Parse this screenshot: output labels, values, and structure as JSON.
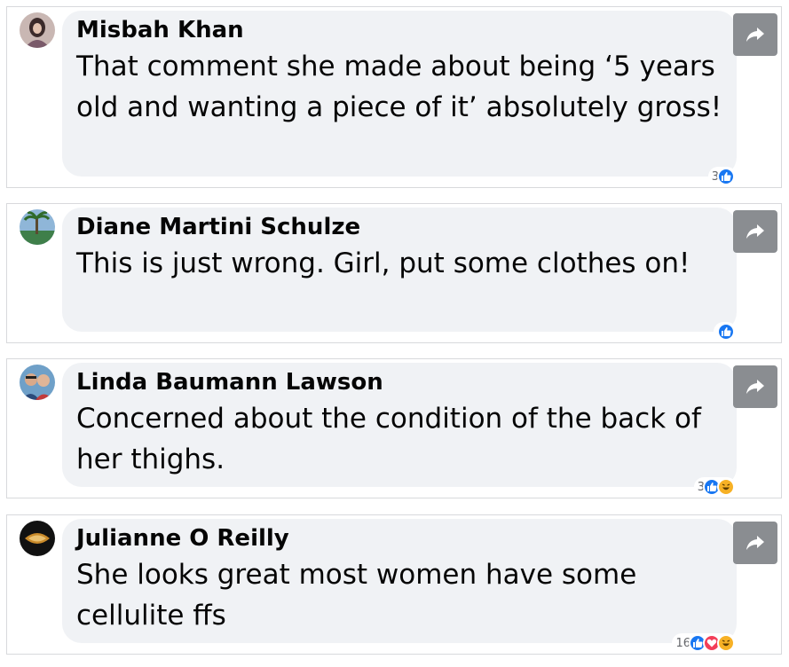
{
  "comments": [
    {
      "author": "Misbah Khan",
      "text": "That comment she made about being ‘5 years old and wanting a piece of it’ absolutely gross!",
      "reaction_count": "3",
      "reactions": [
        "like"
      ]
    },
    {
      "author": "Diane Martini Schulze",
      "text": "This is just wrong. Girl, put some clothes on!",
      "reaction_count": "",
      "reactions": [
        "like"
      ]
    },
    {
      "author": "Linda Baumann Lawson",
      "text": "Concerned about the condition of the back of her thighs.",
      "reaction_count": "3",
      "reactions": [
        "like",
        "haha"
      ]
    },
    {
      "author": "Julianne O Reilly",
      "text": "She looks great most women have some cellulite ffs",
      "reaction_count": "16",
      "reactions": [
        "like",
        "love",
        "haha"
      ]
    }
  ],
  "colors": {
    "like": "#1877f2",
    "love": "#f33e58",
    "haha": "#f7b125",
    "bubble": "#f0f2f5",
    "share_button": "#8a8d91"
  },
  "icons": {
    "share": "share-arrow-icon",
    "like": "like-thumb-icon",
    "love": "love-heart-icon",
    "haha": "haha-face-icon"
  }
}
